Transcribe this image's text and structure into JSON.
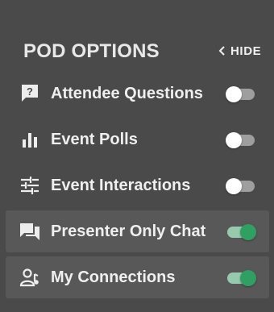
{
  "header": {
    "title": "POD OPTIONS",
    "hide_label": "HIDE"
  },
  "colors": {
    "panel_background": "#4a4a4a",
    "active_row_background": "#585858",
    "toggle_on_knob": "#2f9f62",
    "toggle_on_track": "#97c9ac",
    "toggle_off_track": "#9e9e9e"
  },
  "options": [
    {
      "label": "Attendee Questions",
      "icon": "question-bubble-icon",
      "enabled": false
    },
    {
      "label": "Event Polls",
      "icon": "bar-chart-icon",
      "enabled": false
    },
    {
      "label": "Event Interactions",
      "icon": "sliders-icon",
      "enabled": false
    },
    {
      "label": "Presenter Only Chat",
      "icon": "chat-icon",
      "enabled": true
    },
    {
      "label": "My Connections",
      "icon": "user-connections-icon",
      "enabled": true
    }
  ]
}
